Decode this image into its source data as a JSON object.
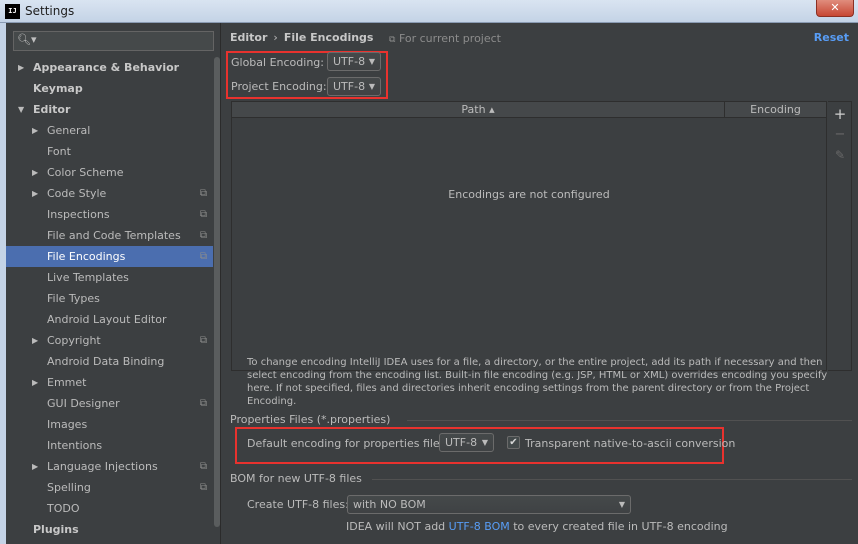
{
  "window": {
    "title": "Settings",
    "icon_text": "IJ",
    "close_label": "✕"
  },
  "search": {
    "placeholder": ""
  },
  "sidebar": {
    "items": [
      {
        "label": "Appearance & Behavior",
        "level": 0,
        "bold": true,
        "expandable": true,
        "expanded": false,
        "project": false
      },
      {
        "label": "Keymap",
        "level": 0,
        "bold": true,
        "expandable": false,
        "project": false
      },
      {
        "label": "Editor",
        "level": 0,
        "bold": true,
        "expandable": true,
        "expanded": true,
        "project": false
      },
      {
        "label": "General",
        "level": 1,
        "bold": false,
        "expandable": true,
        "expanded": false,
        "project": false
      },
      {
        "label": "Font",
        "level": 1,
        "bold": false,
        "expandable": false,
        "project": false
      },
      {
        "label": "Color Scheme",
        "level": 1,
        "bold": false,
        "expandable": true,
        "expanded": false,
        "project": false
      },
      {
        "label": "Code Style",
        "level": 1,
        "bold": false,
        "expandable": true,
        "expanded": false,
        "project": true
      },
      {
        "label": "Inspections",
        "level": 1,
        "bold": false,
        "expandable": false,
        "project": true
      },
      {
        "label": "File and Code Templates",
        "level": 1,
        "bold": false,
        "expandable": false,
        "project": true
      },
      {
        "label": "File Encodings",
        "level": 1,
        "bold": false,
        "expandable": false,
        "project": true,
        "selected": true
      },
      {
        "label": "Live Templates",
        "level": 1,
        "bold": false,
        "expandable": false,
        "project": false
      },
      {
        "label": "File Types",
        "level": 1,
        "bold": false,
        "expandable": false,
        "project": false
      },
      {
        "label": "Android Layout Editor",
        "level": 1,
        "bold": false,
        "expandable": false,
        "project": false
      },
      {
        "label": "Copyright",
        "level": 1,
        "bold": false,
        "expandable": true,
        "expanded": false,
        "project": true
      },
      {
        "label": "Android Data Binding",
        "level": 1,
        "bold": false,
        "expandable": false,
        "project": false
      },
      {
        "label": "Emmet",
        "level": 1,
        "bold": false,
        "expandable": true,
        "expanded": false,
        "project": false
      },
      {
        "label": "GUI Designer",
        "level": 1,
        "bold": false,
        "expandable": false,
        "project": true
      },
      {
        "label": "Images",
        "level": 1,
        "bold": false,
        "expandable": false,
        "project": false
      },
      {
        "label": "Intentions",
        "level": 1,
        "bold": false,
        "expandable": false,
        "project": false
      },
      {
        "label": "Language Injections",
        "level": 1,
        "bold": false,
        "expandable": true,
        "expanded": false,
        "project": true
      },
      {
        "label": "Spelling",
        "level": 1,
        "bold": false,
        "expandable": false,
        "project": true
      },
      {
        "label": "TODO",
        "level": 1,
        "bold": false,
        "expandable": false,
        "project": false
      },
      {
        "label": "Plugins",
        "level": 0,
        "bold": true,
        "expandable": false,
        "project": false
      }
    ]
  },
  "main": {
    "breadcrumb": {
      "parent": "Editor",
      "separator": "›",
      "current": "File Encodings"
    },
    "for_project": "For current project",
    "reset_label": "Reset",
    "global_encoding": {
      "label": "Global Encoding:",
      "value": "UTF-8"
    },
    "project_encoding": {
      "label": "Project Encoding:",
      "value": "UTF-8"
    },
    "table": {
      "columns": [
        "Path ▴",
        "Encoding"
      ],
      "empty_text": "Encodings are not configured",
      "tools": [
        "+",
        "−",
        "✎"
      ]
    },
    "description": "To change encoding IntelliJ IDEA uses for a file, a directory, or the entire project, add its path if necessary and then select encoding from the encoding list. Built-in file encoding (e.g. JSP, HTML or XML) overrides encoding you specify here. If not specified, files and directories inherit encoding settings from the parent directory or from the Project Encoding.",
    "properties": {
      "title": "Properties Files (*.properties)",
      "default_label": "Default encoding for properties files:",
      "default_value": "UTF-8",
      "transparent_label": "Transparent native-to-ascii conversion",
      "transparent_checked": true
    },
    "bom": {
      "title": "BOM for new UTF-8 files",
      "create_label": "Create UTF-8 files:",
      "create_value": "with NO BOM",
      "note_prefix": "IDEA will NOT add ",
      "note_link": "UTF-8 BOM",
      "note_suffix": " to every created file in UTF-8 encoding"
    }
  },
  "colors": {
    "selection": "#4b6eaf",
    "link": "#589df6",
    "highlight_box": "#e8322e",
    "background": "#3c3f41"
  }
}
